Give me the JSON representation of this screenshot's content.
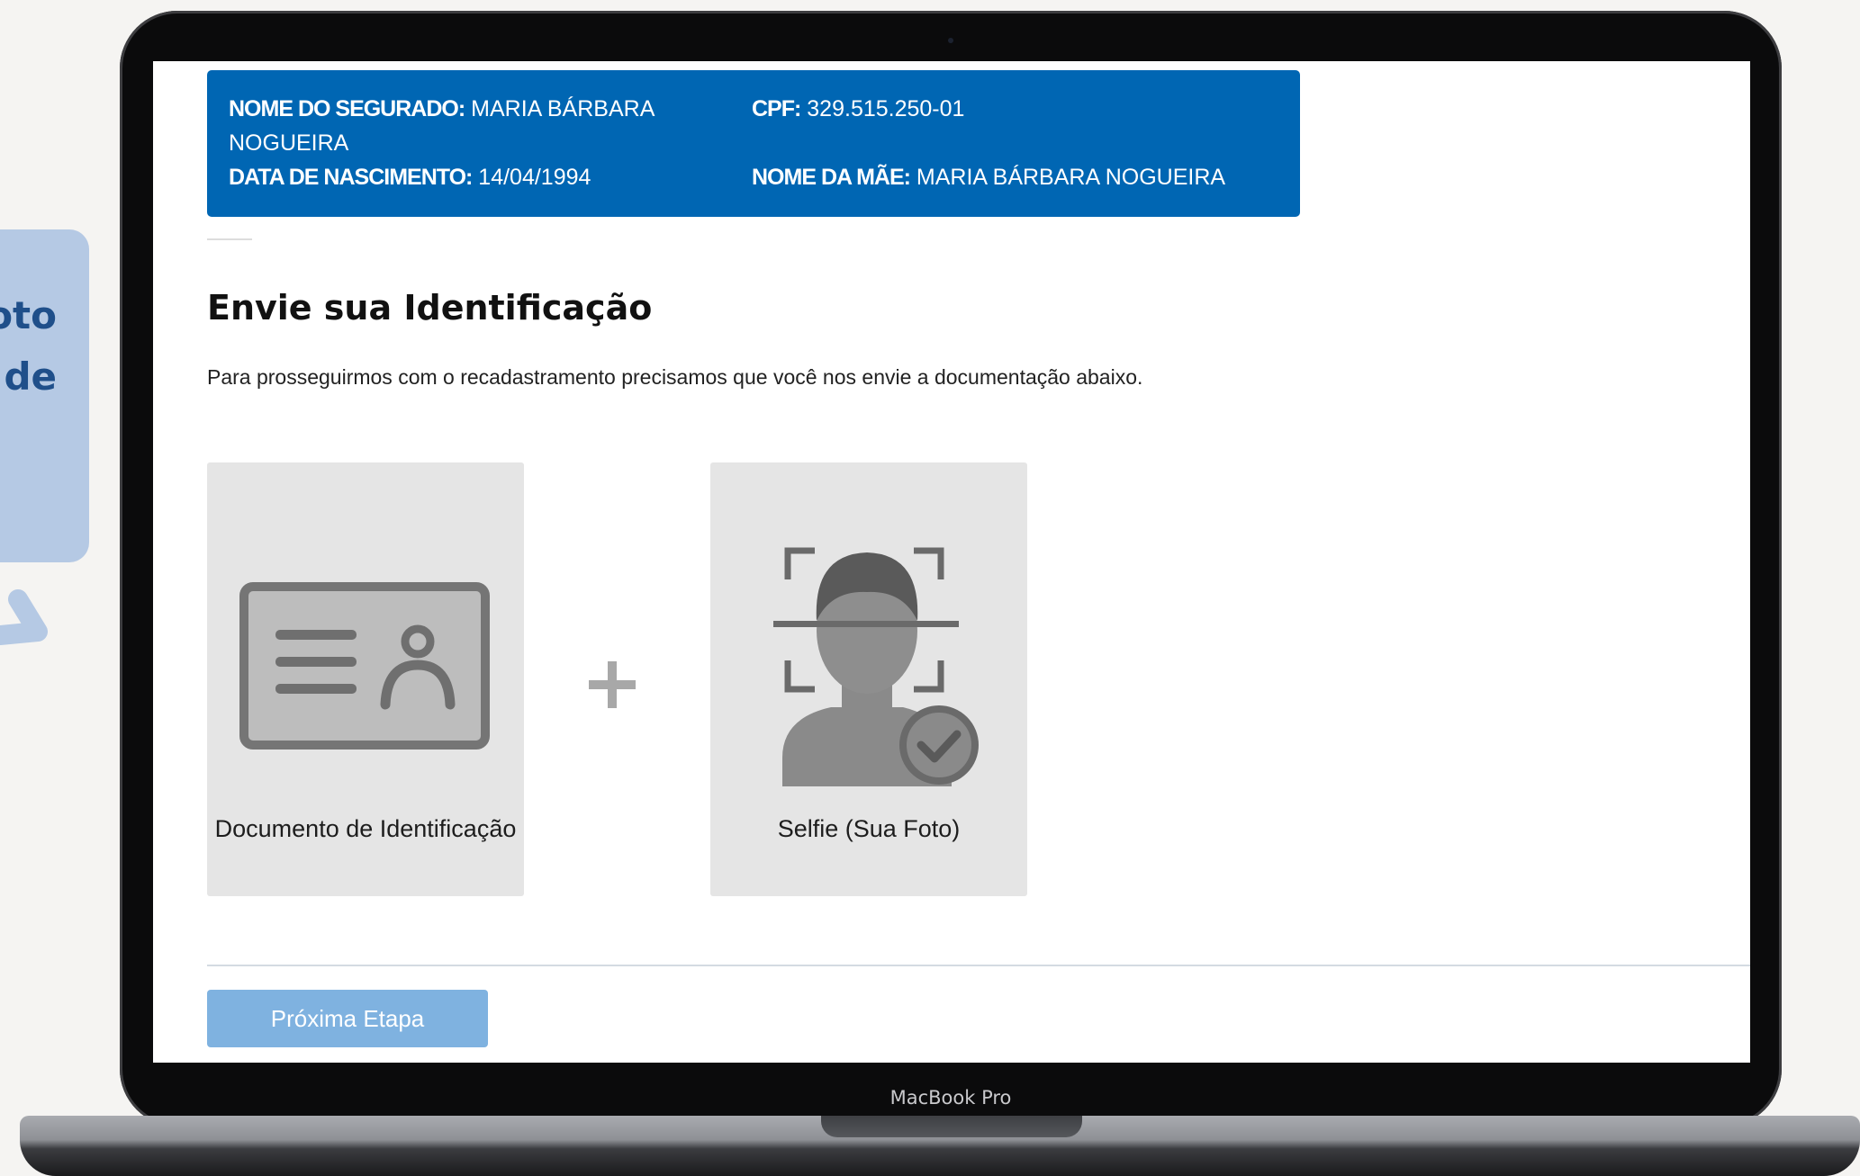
{
  "callout": {
    "text": "oto\nde",
    "arrow_icon": "chevron-right-icon"
  },
  "device": {
    "model": "MacBook Pro"
  },
  "insured_info": {
    "nome_label": "NOME DO SEGURADO:",
    "nome_value": "MARIA BÁRBARA NOGUEIRA",
    "cpf_label": "CPF:",
    "cpf_value": "329.515.250-01",
    "nascimento_label": "DATA DE NASCIMENTO:",
    "nascimento_value": "14/04/1994",
    "mae_label": "NOME DA MÃE:",
    "mae_value": "MARIA BÁRBARA NOGUEIRA"
  },
  "main": {
    "title": "Envie sua Identificação",
    "description": "Para prosseguirmos com o recadastramento precisamos que você nos envie a documentação abaixo.",
    "cards": [
      {
        "label": "Documento de Identificação",
        "icon": "id-card-icon"
      },
      {
        "label": "Selfie (Sua Foto)",
        "icon": "selfie-face-scan-icon"
      }
    ],
    "separator_icon": "plus-icon"
  },
  "actions": {
    "next_label": "Próxima Etapa"
  },
  "colors": {
    "header_blue": "#0066b3",
    "button_blue": "#7fb2e0",
    "card_gray": "#e5e5e5",
    "icon_gray": "#7a7a7a",
    "callout_bg": "#b5c9e4"
  }
}
